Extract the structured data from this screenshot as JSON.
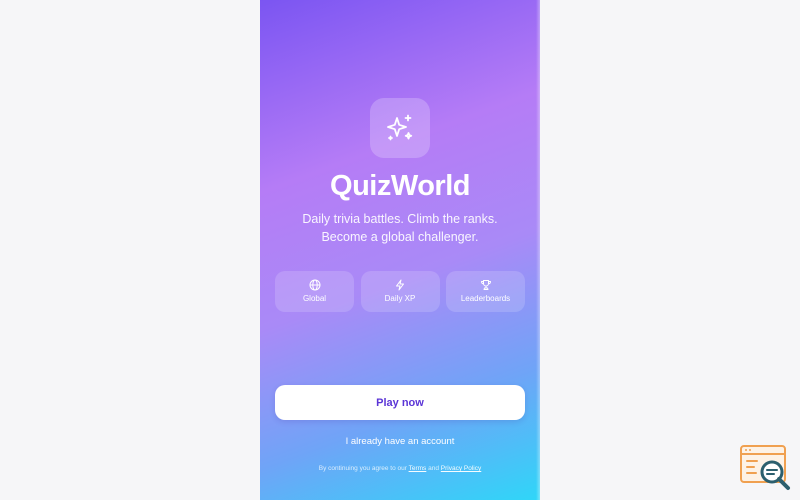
{
  "app": {
    "name": "QuizWorld",
    "tagline_line1": "Daily trivia battles. Climb the ranks.",
    "tagline_line2": "Become a global challenger."
  },
  "features": [
    {
      "label": "Global",
      "icon": "globe-icon"
    },
    {
      "label": "Daily XP",
      "icon": "lightning-icon"
    },
    {
      "label": "Leaderboards",
      "icon": "trophy-icon"
    }
  ],
  "actions": {
    "play_label": "Play now",
    "account_label": "I already have an account"
  },
  "legal": {
    "prefix": "By continuing you agree to our",
    "terms": "Terms",
    "and": "and",
    "privacy": "Privacy Policy"
  },
  "colors": {
    "gradient_start": "#7b55f2",
    "gradient_mid": "#b57cf6",
    "gradient_end": "#2fd6f8",
    "button_text": "#5b35d6",
    "background": "#f6f6f8"
  }
}
